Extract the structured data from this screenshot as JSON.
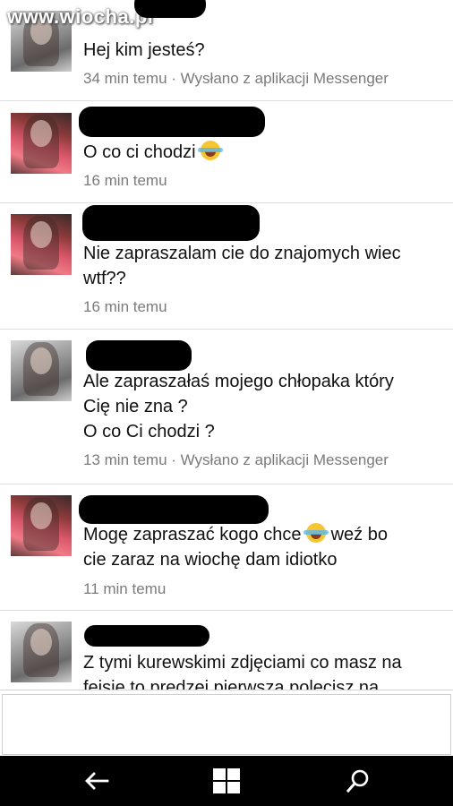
{
  "watermark": "www.wiocha.pl",
  "messages": [
    {
      "text": "Hej kim jesteś?",
      "time": "34 min temu",
      "via": " · Wysłano z aplikacji Messenger"
    },
    {
      "text": "O co ci chodzi",
      "time": "16 min temu",
      "via": ""
    },
    {
      "text": "Nie zapraszalam cie do znajomych wiec\nwtf??",
      "time": "16 min temu",
      "via": ""
    },
    {
      "text": "Ale zapraszałaś mojego chłopaka który\nCię nie zna ?\nO co Ci chodzi ?",
      "time": "13 min temu",
      "via": " · Wysłano z aplikacji Messenger"
    },
    {
      "text_before": "Mogę zapraszać kogo chce ",
      "text_after": " weź bo",
      "text_line2": "cie zaraz na wiochę dam idiotko",
      "time": "11 min temu",
      "via": ""
    },
    {
      "text": "Z tymi kurewskimi zdjęciami co masz na\nfejsie to predzej pierwsza polecisz na"
    }
  ],
  "emoji": "laughing-tears-emoji",
  "composer": {
    "placeholder": ""
  },
  "navbar": {
    "back": "back-arrow-icon",
    "home": "windows-logo-icon",
    "search": "search-icon"
  },
  "colors": {
    "nav_bg": "#000000",
    "meta_text": "#7a7a7a",
    "separator": "#dedede"
  }
}
